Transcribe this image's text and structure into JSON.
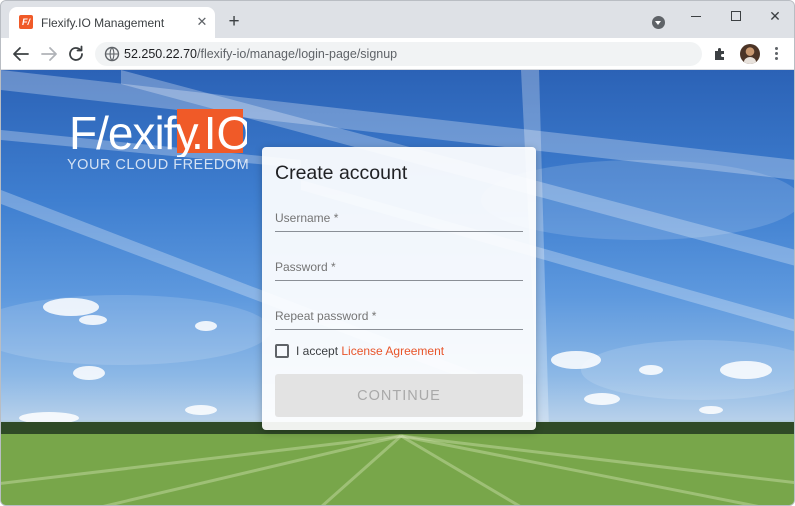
{
  "browser": {
    "tab_title": "Flexify.IO Management",
    "tab_favicon_text": "F/",
    "tab_close_glyph": "✕",
    "new_tab_glyph": "+",
    "close_window_glyph": "✕",
    "url_host": "52.250.22.70",
    "url_path": "/flexify-io/manage/login-page/signup",
    "icons": [
      "back-arrow-icon",
      "forward-arrow-icon",
      "reload-icon",
      "site-info-icon",
      "extensions-puzzle-icon",
      "profile-avatar-icon",
      "kebab-menu-icon"
    ]
  },
  "brand": {
    "logo_text": "Flexify.IO",
    "tagline": "YOUR CLOUD FREEDOM",
    "accent_color": "#f05a28"
  },
  "signup": {
    "title": "Create account",
    "username_placeholder": "Username *",
    "password_placeholder": "Password *",
    "repeat_password_placeholder": "Repeat password *",
    "accept_text": "I accept ",
    "license_link": "License Agreement",
    "continue_label": "CONTINUE",
    "checkbox_checked": false,
    "continue_enabled": false
  }
}
